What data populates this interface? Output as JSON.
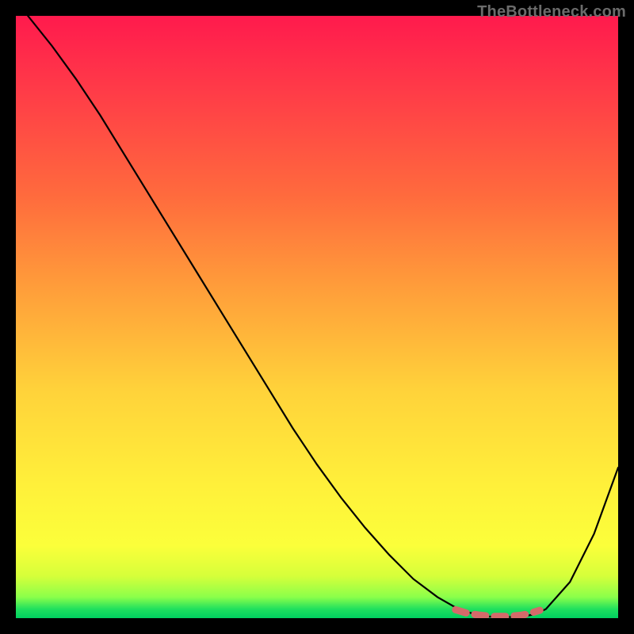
{
  "watermark": "TheBottleneck.com",
  "chart_data": {
    "type": "line",
    "title": "",
    "xlabel": "",
    "ylabel": "",
    "xlim": [
      0,
      100
    ],
    "ylim": [
      0,
      100
    ],
    "series": [
      {
        "name": "curve",
        "color": "#000000",
        "x": [
          2,
          6,
          10,
          14,
          18,
          22,
          26,
          30,
          34,
          38,
          42,
          46,
          50,
          54,
          58,
          62,
          66,
          70,
          74,
          78,
          80,
          82,
          84,
          86,
          88,
          92,
          96,
          100
        ],
        "y": [
          100,
          95,
          89.5,
          83.5,
          77,
          70.5,
          64,
          57.5,
          51,
          44.5,
          38,
          31.5,
          25.5,
          20,
          15,
          10.5,
          6.5,
          3.5,
          1.2,
          0.3,
          0.2,
          0.2,
          0.3,
          0.6,
          1.5,
          6,
          14,
          25
        ]
      },
      {
        "name": "valley-highlight",
        "color": "#d46a6a",
        "style": "dashed",
        "x": [
          73,
          75,
          77,
          78,
          79,
          80,
          81,
          82,
          83,
          84,
          85,
          86,
          87
        ],
        "y": [
          1.4,
          0.8,
          0.5,
          0.4,
          0.3,
          0.3,
          0.3,
          0.3,
          0.4,
          0.5,
          0.7,
          1.0,
          1.3
        ]
      }
    ]
  }
}
